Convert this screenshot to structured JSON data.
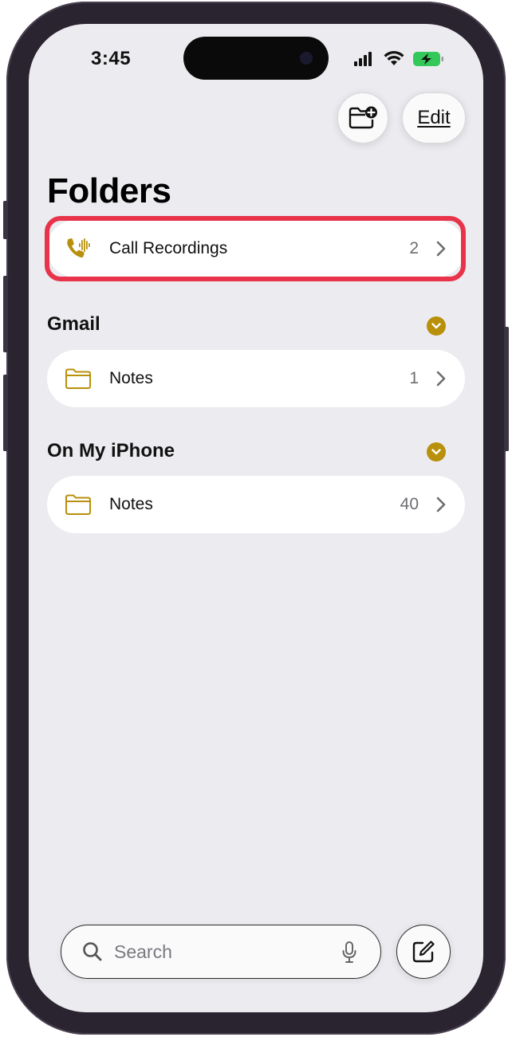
{
  "status_bar": {
    "time": "3:45",
    "icons": [
      "cellular-signal-icon",
      "wifi-icon",
      "battery-charging-icon"
    ]
  },
  "toolbar": {
    "new_folder_icon": "new-folder-icon",
    "edit_label": "Edit"
  },
  "title": "Folders",
  "pinned_folder": {
    "icon": "phone-waveform-icon",
    "label": "Call Recordings",
    "count": "2"
  },
  "sections": [
    {
      "header": "Gmail",
      "folders": [
        {
          "icon": "folder-icon",
          "label": "Notes",
          "count": "1"
        }
      ]
    },
    {
      "header": "On My iPhone",
      "folders": [
        {
          "icon": "folder-icon",
          "label": "Notes",
          "count": "40"
        }
      ]
    }
  ],
  "search": {
    "placeholder": "Search"
  },
  "colors": {
    "accent": "#b8900c",
    "highlight": "#e8334a",
    "background": "#ececf0"
  }
}
